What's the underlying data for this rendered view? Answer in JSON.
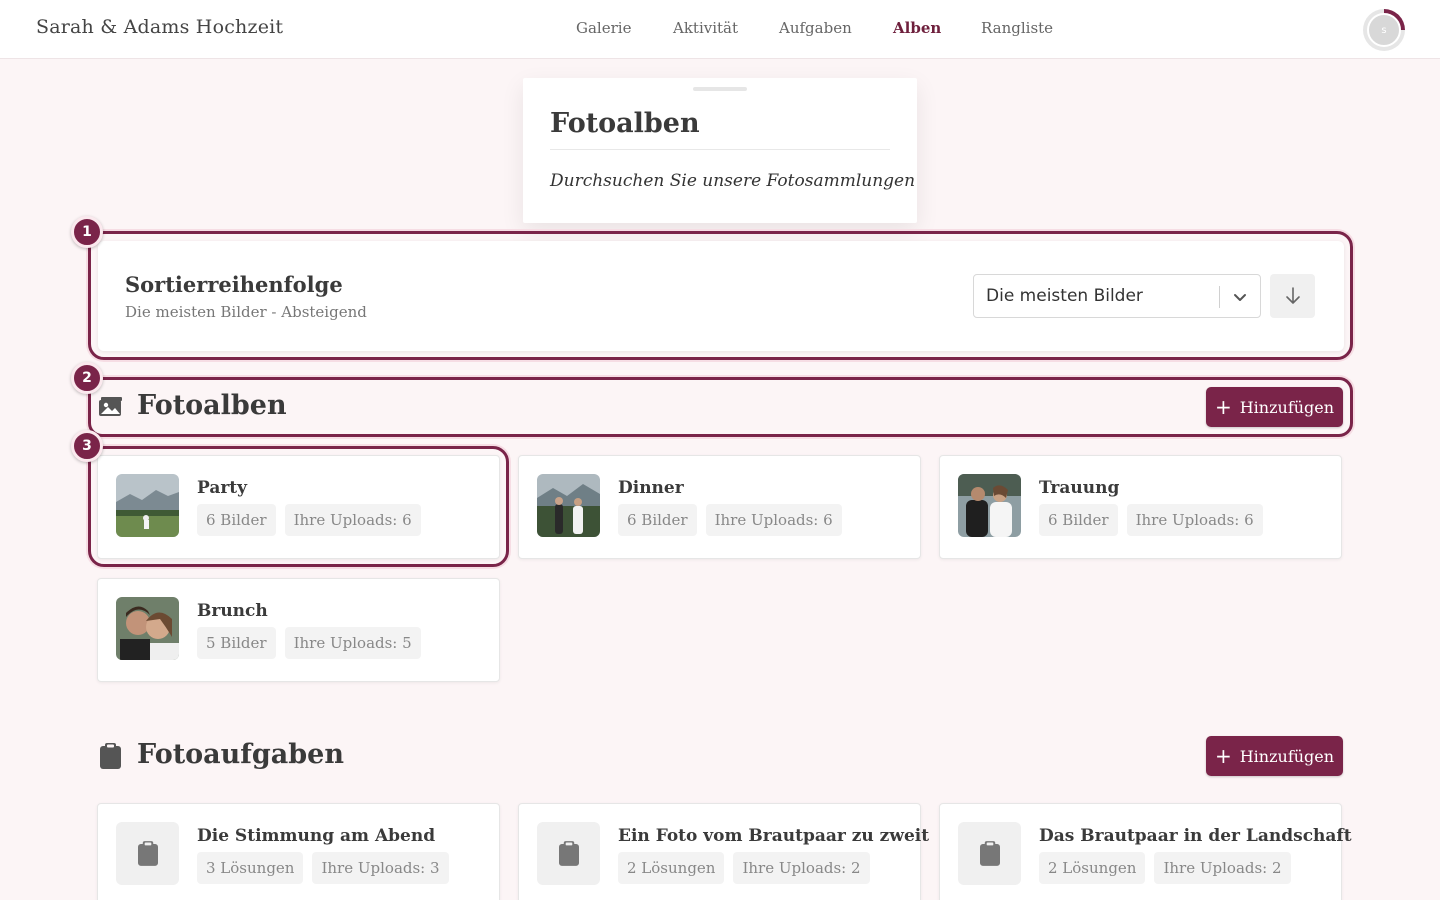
{
  "header": {
    "brand": "Sarah & Adams Hochzeit",
    "nav": [
      "Galerie",
      "Aktivität",
      "Aufgaben",
      "Alben",
      "Rangliste"
    ],
    "active_nav": "Alben",
    "avatar_initial": "s"
  },
  "title_card": {
    "title": "Fotoalben",
    "subtitle": "Durchsuchen Sie unsere Fotosammlungen"
  },
  "markers": [
    "1",
    "2",
    "3"
  ],
  "sort": {
    "title": "Sortierreihenfolge",
    "summary": "Die meisten Bilder - Absteigend",
    "selected": "Die meisten Bilder",
    "direction_icon": "arrow-down-icon"
  },
  "albums_section": {
    "title": "Fotoalben",
    "icon": "image-icon",
    "add_label": "Hinzufügen",
    "items": [
      {
        "name": "Party",
        "count": "6 Bilder",
        "uploads": "Ihre Uploads: 6"
      },
      {
        "name": "Dinner",
        "count": "6 Bilder",
        "uploads": "Ihre Uploads: 6"
      },
      {
        "name": "Trauung",
        "count": "6 Bilder",
        "uploads": "Ihre Uploads: 6"
      },
      {
        "name": "Brunch",
        "count": "5 Bilder",
        "uploads": "Ihre Uploads: 5"
      }
    ]
  },
  "tasks_section": {
    "title": "Fotoaufgaben",
    "icon": "clipboard-icon",
    "add_label": "Hinzufügen",
    "items": [
      {
        "name": "Die Stimmung am Abend",
        "count": "3 Lösungen",
        "uploads": "Ihre Uploads: 3"
      },
      {
        "name": "Ein Foto vom Brautpaar zu zweit",
        "count": "2 Lösungen",
        "uploads": "Ihre Uploads: 2"
      },
      {
        "name": "Das Brautpaar in der Landschaft",
        "count": "2 Lösungen",
        "uploads": "Ihre Uploads: 2"
      }
    ]
  },
  "colors": {
    "accent": "#7a2449",
    "background": "#fcf5f6"
  }
}
